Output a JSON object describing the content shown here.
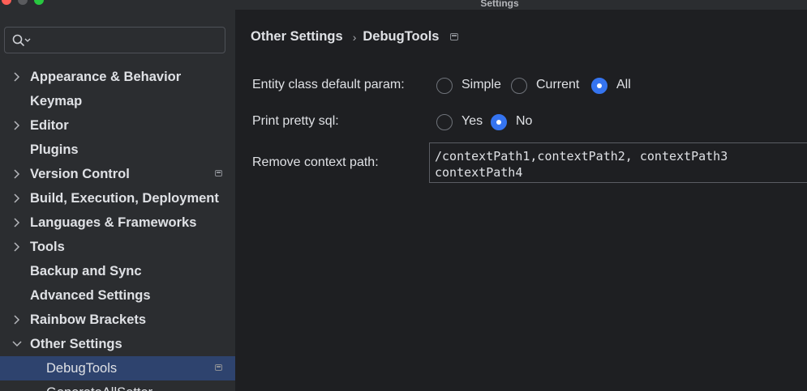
{
  "window": {
    "title": "Settings"
  },
  "search": {
    "placeholder": "",
    "value": ""
  },
  "sidebar": {
    "items": [
      {
        "label": "Appearance & Behavior",
        "expandable": true,
        "expanded": false,
        "badge": false
      },
      {
        "label": "Keymap",
        "expandable": false,
        "badge": false
      },
      {
        "label": "Editor",
        "expandable": true,
        "expanded": false,
        "badge": false
      },
      {
        "label": "Plugins",
        "expandable": false,
        "badge": false
      },
      {
        "label": "Version Control",
        "expandable": true,
        "expanded": false,
        "badge": true
      },
      {
        "label": "Build, Execution, Deployment",
        "expandable": true,
        "expanded": false,
        "badge": false
      },
      {
        "label": "Languages & Frameworks",
        "expandable": true,
        "expanded": false,
        "badge": false
      },
      {
        "label": "Tools",
        "expandable": true,
        "expanded": false,
        "badge": false
      },
      {
        "label": "Backup and Sync",
        "expandable": false,
        "badge": false
      },
      {
        "label": "Advanced Settings",
        "expandable": false,
        "badge": false
      },
      {
        "label": "Rainbow Brackets",
        "expandable": true,
        "expanded": false,
        "badge": false
      },
      {
        "label": "Other Settings",
        "expandable": true,
        "expanded": true,
        "badge": false
      },
      {
        "label": "DebugTools",
        "child": true,
        "selected": true,
        "badge": true
      },
      {
        "label": "GenerateAllSetter",
        "child": true,
        "partial": true,
        "badge": false
      }
    ]
  },
  "breadcrumb": {
    "parent": "Other Settings",
    "separator": "›",
    "current": "DebugTools"
  },
  "form": {
    "entity_param": {
      "label": "Entity class default param:",
      "options": [
        "Simple",
        "Current",
        "All"
      ],
      "selected": "All"
    },
    "print_sql": {
      "label": "Print pretty sql:",
      "options": [
        "Yes",
        "No"
      ],
      "selected": "No"
    },
    "remove_context": {
      "label": "Remove context path:",
      "value": "/contextPath1,contextPath2, contextPath3\ncontextPath4"
    }
  },
  "colors": {
    "accent": "#3574f0",
    "selection": "#2e436e",
    "sidebar_bg": "#2b2d30",
    "content_bg": "#1e1f22"
  }
}
